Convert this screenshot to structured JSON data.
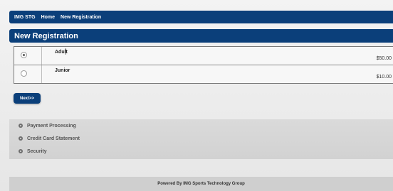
{
  "nav": {
    "items": [
      "IMG STG",
      "Home",
      "New Registration"
    ]
  },
  "page": {
    "title": "New Registration"
  },
  "options": [
    {
      "name": "Adult",
      "price": "$50.00",
      "selected": true
    },
    {
      "name": "Junior",
      "price": "$10.00",
      "selected": false
    }
  ],
  "actions": {
    "next_label": "Next>>"
  },
  "sections": [
    "Payment Processing",
    "Credit Card Statement",
    "Security"
  ],
  "footer": {
    "text": "Powered By IMG Sports Technology Group"
  },
  "colors": {
    "header_blue": "#0b3f7a",
    "page_bg": "#e9e9e9"
  }
}
